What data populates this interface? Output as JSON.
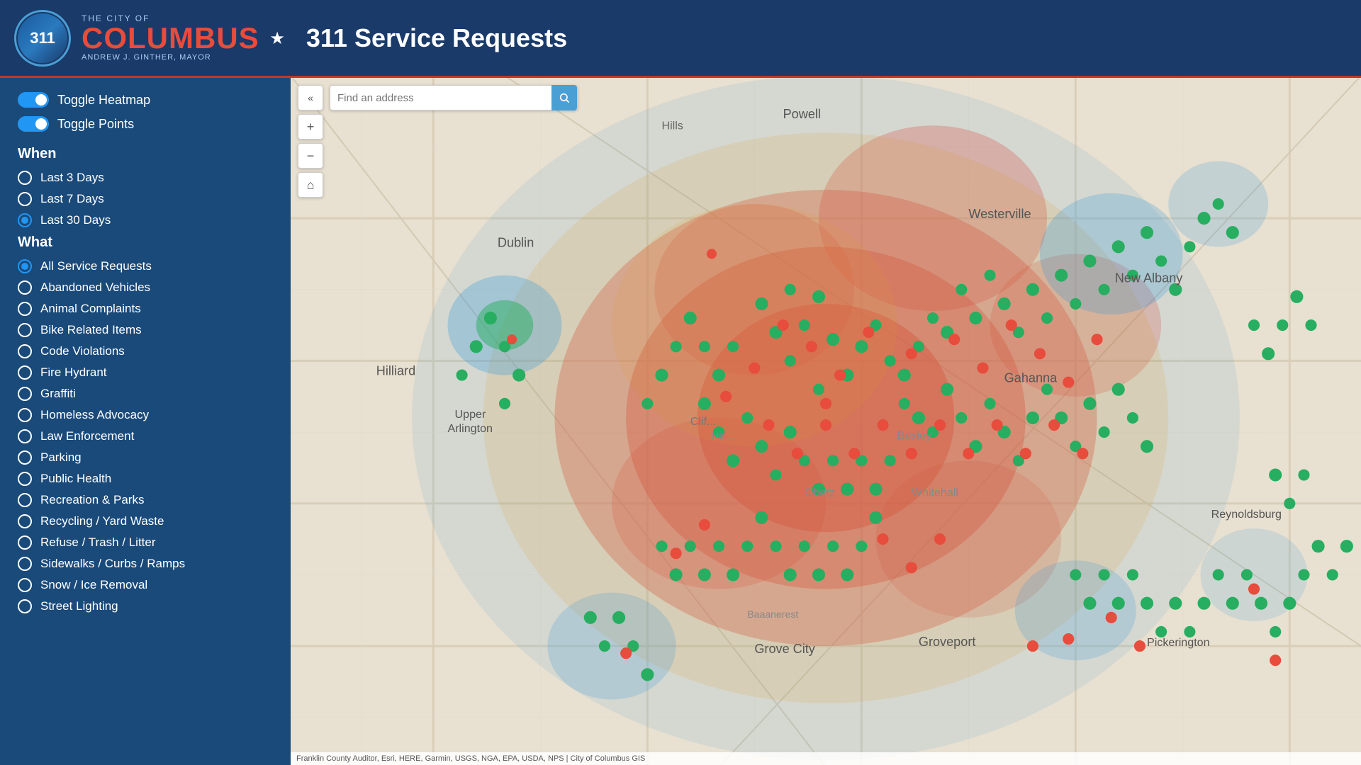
{
  "header": {
    "city_of": "THE CITY OF",
    "columbus": "COLUMB",
    "us_accent": "US",
    "star": "★",
    "mayor": "ANDREW J. GINTHER, MAYOR",
    "title": "311 Service Requests",
    "logo_text": "311"
  },
  "sidebar": {
    "toggles": [
      {
        "id": "toggle-heatmap",
        "label": "Toggle Heatmap",
        "enabled": true
      },
      {
        "id": "toggle-points",
        "label": "Toggle Points",
        "enabled": true
      }
    ],
    "when": {
      "title": "When",
      "options": [
        {
          "id": "last3",
          "label": "Last 3 Days",
          "selected": false
        },
        {
          "id": "last7",
          "label": "Last 7 Days",
          "selected": false
        },
        {
          "id": "last30",
          "label": "Last 30 Days",
          "selected": true
        }
      ]
    },
    "what": {
      "title": "What",
      "options": [
        {
          "id": "all",
          "label": "All Service Requests",
          "selected": true
        },
        {
          "id": "abandoned",
          "label": "Abandoned Vehicles",
          "selected": false
        },
        {
          "id": "animal",
          "label": "Animal Complaints",
          "selected": false
        },
        {
          "id": "bike",
          "label": "Bike Related Items",
          "selected": false
        },
        {
          "id": "code",
          "label": "Code Violations",
          "selected": false
        },
        {
          "id": "hydrant",
          "label": "Fire Hydrant",
          "selected": false
        },
        {
          "id": "graffiti",
          "label": "Graffiti",
          "selected": false
        },
        {
          "id": "homeless",
          "label": "Homeless Advocacy",
          "selected": false
        },
        {
          "id": "law",
          "label": "Law Enforcement",
          "selected": false
        },
        {
          "id": "parking",
          "label": "Parking",
          "selected": false
        },
        {
          "id": "public_health",
          "label": "Public Health",
          "selected": false
        },
        {
          "id": "recreation",
          "label": "Recreation & Parks",
          "selected": false
        },
        {
          "id": "recycling",
          "label": "Recycling / Yard Waste",
          "selected": false
        },
        {
          "id": "refuse",
          "label": "Refuse / Trash / Litter",
          "selected": false
        },
        {
          "id": "sidewalks",
          "label": "Sidewalks / Curbs / Ramps",
          "selected": false
        },
        {
          "id": "snow",
          "label": "Snow / Ice Removal",
          "selected": false
        },
        {
          "id": "street_lighting",
          "label": "Street Lighting",
          "selected": false
        }
      ]
    }
  },
  "map": {
    "search_placeholder": "Find an address",
    "attribution": "Franklin County Auditor, Esri, HERE, Garmin, USGS, NGA, EPA, USDA, NPS | City of Columbus GIS",
    "locations": [
      "Powell",
      "Hills",
      "Dublin",
      "Westerville",
      "New Albany",
      "Hilliard",
      "Upper Arlington",
      "Gahanna",
      "Grove City",
      "Groveport",
      "Pickerington",
      "Reynoldsburg"
    ],
    "zoom_in": "+",
    "zoom_out": "−",
    "home": "⌂",
    "back_chevron": "«"
  },
  "colors": {
    "background": "#1a4a7a",
    "accent_blue": "#2196F3",
    "header_red": "#c0392b",
    "heatmap_hot": "#e74c3c",
    "heatmap_warm": "#f39c12",
    "heatmap_cool": "#3498db",
    "point_green": "#27ae60",
    "point_red": "#e74c3c"
  }
}
